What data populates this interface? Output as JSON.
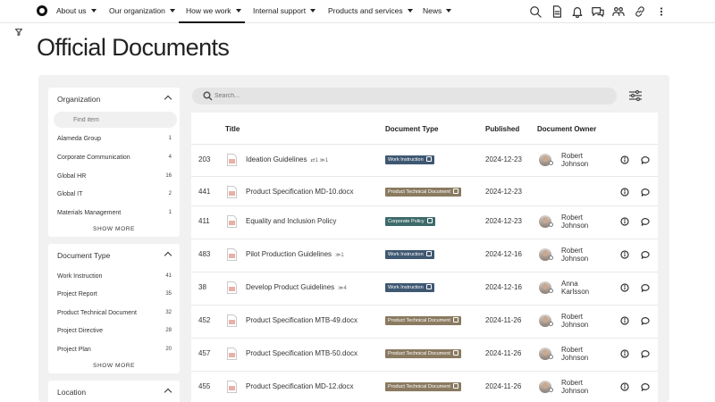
{
  "nav": {
    "items": [
      {
        "label": "About us",
        "active": false
      },
      {
        "label": "Our organization",
        "active": false
      },
      {
        "label": "How we work",
        "active": true
      },
      {
        "label": "Internal support",
        "active": false
      },
      {
        "label": "Products and services",
        "active": false
      },
      {
        "label": "News",
        "active": false
      }
    ],
    "icons": [
      "search-icon",
      "document-icon",
      "bell-icon",
      "chat-icon",
      "people-icon",
      "link-icon",
      "more-vertical-icon"
    ]
  },
  "page": {
    "title": "Official Documents"
  },
  "sidebar": {
    "organization": {
      "heading": "Organization",
      "filter_placeholder": "Find item",
      "items": [
        {
          "label": "Alameda Group",
          "count": "1"
        },
        {
          "label": "Corporate Communication",
          "count": "4"
        },
        {
          "label": "Global HR",
          "count": "16"
        },
        {
          "label": "Global IT",
          "count": "2"
        },
        {
          "label": "Materials Management",
          "count": "1"
        }
      ],
      "show_more": "SHOW MORE"
    },
    "document_type": {
      "heading": "Document Type",
      "items": [
        {
          "label": "Work Instruction",
          "count": "41"
        },
        {
          "label": "Project Report",
          "count": "35"
        },
        {
          "label": "Product Technical Document",
          "count": "32"
        },
        {
          "label": "Project Directive",
          "count": "28"
        },
        {
          "label": "Project Plan",
          "count": "20"
        }
      ],
      "show_more": "SHOW MORE"
    },
    "location": {
      "heading": "Location"
    }
  },
  "search": {
    "placeholder": "Search..."
  },
  "table": {
    "headers": {
      "title": "Title",
      "type": "Document Type",
      "published": "Published",
      "owner": "Document Owner"
    },
    "rows": [
      {
        "id": "203",
        "title": "Ideation Guidelines",
        "suffix": "⇄1  ≫1",
        "type": "Work Instruction",
        "published": "2024-12-23",
        "owner": [
          "Robert",
          "Johnson"
        ]
      },
      {
        "id": "441",
        "title": "Product Specification MD-10.docx",
        "suffix": "",
        "type": "Product Technical Document",
        "published": "2024-12-23",
        "owner": []
      },
      {
        "id": "411",
        "title": "Equality and Inclusion Policy",
        "suffix": "",
        "type": "Corporate Policy",
        "published": "2024-12-23",
        "owner": [
          "Robert",
          "Johnson"
        ]
      },
      {
        "id": "483",
        "title": "Pilot Production Guidelines",
        "suffix": "≫1",
        "type": "Work Instruction",
        "published": "2024-12-16",
        "owner": [
          "Robert",
          "Johnson"
        ]
      },
      {
        "id": "38",
        "title": "Develop Product Guidelines",
        "suffix": "≫4",
        "type": "Work Instruction",
        "published": "2024-12-16",
        "owner": [
          "Anna",
          "Karlsson"
        ]
      },
      {
        "id": "452",
        "title": "Product Specification MTB-49.docx",
        "suffix": "",
        "type": "Product Technical Document",
        "published": "2024-11-26",
        "owner": [
          "Robert",
          "Johnson"
        ]
      },
      {
        "id": "457",
        "title": "Product Specification MTB-50.docx",
        "suffix": "",
        "type": "Product Technical Document",
        "published": "2024-11-26",
        "owner": [
          "Robert",
          "Johnson"
        ]
      },
      {
        "id": "455",
        "title": "Product Specification MD-12.docx",
        "suffix": "",
        "type": "Product Technical Document",
        "published": "2024-11-26",
        "owner": [
          "Robert",
          "Johnson"
        ]
      }
    ]
  },
  "colors": {
    "work_instruction": "#3f5872",
    "product_technical": "#8a7a60",
    "corporate_policy": "#3d6a6a",
    "doc_icon": "#e8b0a8"
  }
}
